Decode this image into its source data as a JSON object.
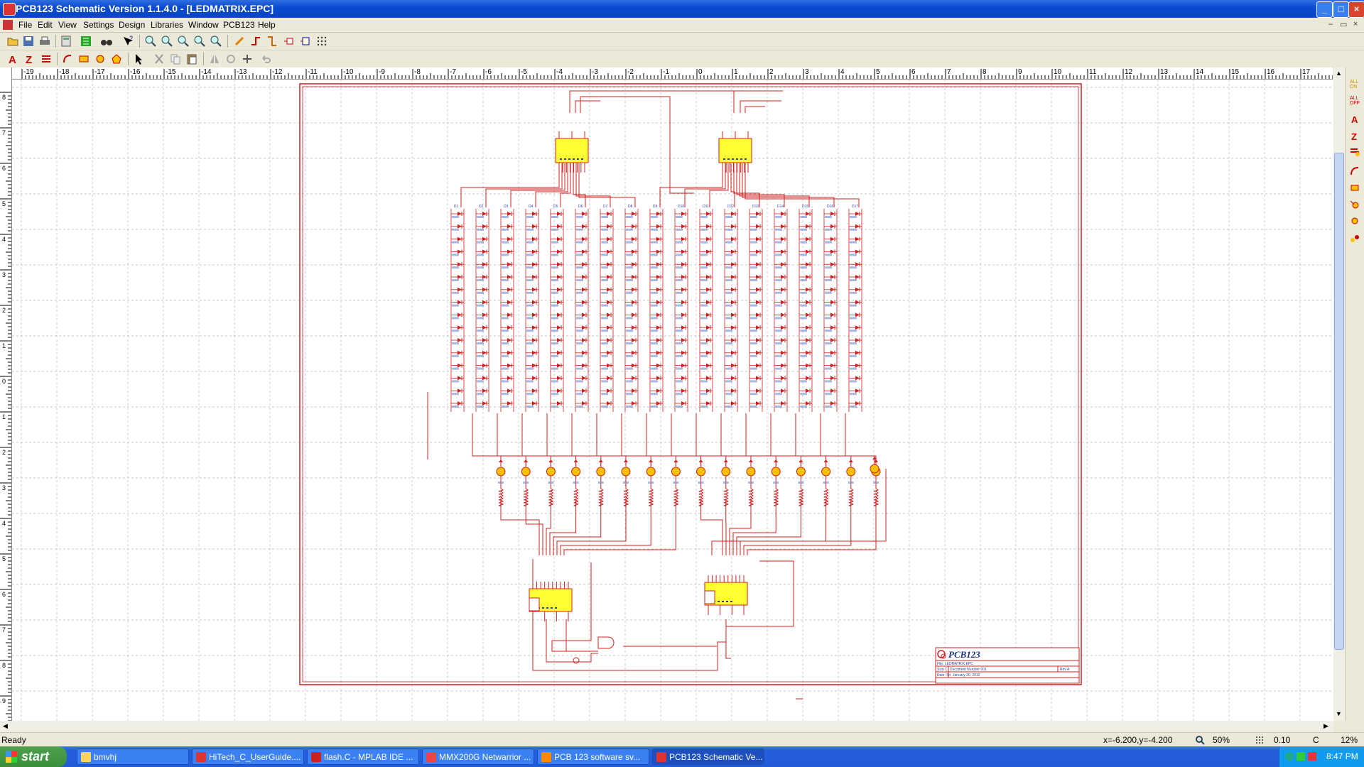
{
  "window": {
    "title": "PCB123 Schematic Version 1.1.4.0 - [LEDMATRIX.EPC]",
    "controls": [
      "_",
      "□",
      "×"
    ],
    "mdi_controls": [
      "–",
      "▭",
      "×"
    ]
  },
  "menu": [
    "File",
    "Edit",
    "View",
    "Settings",
    "Design",
    "Libraries",
    "Window",
    "PCB123",
    "Help"
  ],
  "ruler": {
    "h_labels": [
      "-19",
      "-18",
      "-17",
      "-16",
      "-15",
      "-14",
      "-13",
      "-12",
      "-11",
      "-10",
      "-9",
      "-8",
      "-7",
      "-6",
      "-5",
      "-4",
      "-3",
      "-2",
      "-1",
      "0",
      "1",
      "2",
      "3",
      "4",
      "5",
      "6",
      "7",
      "8",
      "9",
      "10",
      "11",
      "12",
      "13",
      "14",
      "15",
      "16",
      "17"
    ],
    "v_labels": [
      "8",
      "7",
      "6",
      "5",
      "4",
      "3",
      "2",
      "1",
      "0",
      "1",
      "2",
      "3",
      "4",
      "5",
      "6",
      "7",
      "8",
      "9"
    ]
  },
  "title_block": {
    "logo": "PCB123",
    "file_line": "File: LEDMATRIX.EPC",
    "size_line": "Size C",
    "doc_line": "Document Number 001",
    "rev_line": "Rev A",
    "date_line": "Date: Fri, January 20, 2012"
  },
  "status": {
    "left": "Ready",
    "coords": "x=-6.200,y=-4.200",
    "zoom": "50%",
    "grid": "0.10",
    "unit": "C",
    "pct": "12%"
  },
  "taskbar": {
    "start": "start",
    "tasks": [
      "bmvhj",
      "HiTech_C_UserGuide....",
      "flash.C - MPLAB IDE ...",
      "MMX200G Netwarrior ...",
      "PCB 123 software sv...",
      "PCB123 Schematic Ve..."
    ],
    "clock": "8:47 PM"
  },
  "colors": {
    "wire": "#d02020",
    "chip": "#ffff33",
    "titlebar": "#0a4bd0",
    "grid": "#b8b8b8"
  }
}
